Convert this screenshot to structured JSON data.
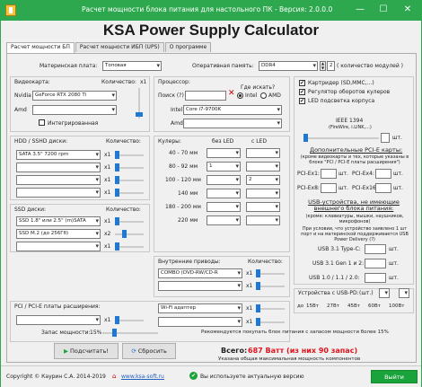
{
  "window": {
    "title": "Расчет мощности блока питания для настольного ПК - Версия: 2.0.0.0",
    "minimize": "—",
    "maximize": "☐",
    "close": "✕"
  },
  "brand": "KSA Power Supply Calculator",
  "tabs": [
    "Расчет мощности БП",
    "Расчет мощности ИБП (UPS)",
    "О программе"
  ],
  "motherboard": {
    "label": "Материнская плата:",
    "value": "Топовая"
  },
  "ram": {
    "label": "Оперативная память:",
    "value": "DDR4",
    "count": "2",
    "count_label": "( количество модулей )"
  },
  "video": {
    "title": "Видеокарта:",
    "count_label": "Количество:",
    "count": "x1",
    "nvidia": "Nvidia",
    "nvidia_value": "GeForce RTX 2080 Ti",
    "amd": "Amd",
    "amd_value": "",
    "integrated": "Интегрированная"
  },
  "cpu": {
    "title": "Процессор:",
    "search": "Поиск (?)",
    "search_value": "",
    "where": "Где искать?",
    "intel_radio": "Intel",
    "amd_radio": "AMD",
    "intel": "Intel",
    "intel_value": "Core i7-9700K",
    "amd": "Amd",
    "amd_value": ""
  },
  "right_checks": [
    {
      "label": "Картридер (SD,MMC,...)",
      "checked": true
    },
    {
      "label": "Регулятор оборотов кулеров",
      "checked": true
    },
    {
      "label": "LED подсветка корпуса",
      "checked": true
    }
  ],
  "ieee": {
    "label1": "IEEE 1394",
    "label2": "(FireWire, i.LINK,...)",
    "unit": "шт."
  },
  "pcie_cards": {
    "title": "Дополнительные PCI-E карты:",
    "note": "(кроме видеокарты и тех, которые указаны в блоке \"PCI / PCI-E платы расширения\")",
    "slots": [
      "PCI-Ex1:",
      "PCI-Ex4:",
      "PCI-Ex8:",
      "PCI-Ex16:"
    ],
    "unit": "шт."
  },
  "usb_devices": {
    "title": "USB-устройства, не имеющие внешнего блока питания:",
    "note": "(кроме: клавиатуры, мышки, наушников, микрофонов)",
    "note2": "При условии, что устройство заявлено 1 шт порт и на материнской поддерживается USB Power Delivery (?)",
    "rows": [
      "USB 3.1 Type-C:",
      "USB 3.1 Gen 1 и 2:",
      "USB 1.0 / 1.1 / 2.0:"
    ],
    "unit": "шт."
  },
  "usbpd": {
    "title": "Устройства с USB-PD:",
    "unit": "(шт.)",
    "watts": [
      "до",
      "15Вт",
      "27Вт",
      "45Вт",
      "60Вт",
      "100Вт"
    ]
  },
  "hdd": {
    "title": "HDD / SSHD диски:",
    "count_label": "Количество:",
    "rows": [
      {
        "value": "SATA 3.5\" 7200 rpm",
        "count": "x1"
      },
      {
        "value": "",
        "count": "x1"
      },
      {
        "value": "",
        "count": "x1"
      },
      {
        "value": "",
        "count": "x1"
      }
    ]
  },
  "coolers": {
    "title": "Кулеры:",
    "no_led": "без LED",
    "led": "с LED",
    "rows": [
      {
        "size": "40 - 70 мм",
        "a": "",
        "b": ""
      },
      {
        "size": "80 - 92 мм",
        "a": "1",
        "b": ""
      },
      {
        "size": "100 - 120 мм",
        "a": "",
        "b": "2"
      },
      {
        "size": "140 мм",
        "a": "",
        "b": ""
      },
      {
        "size": "180 - 200 мм",
        "a": "",
        "b": ""
      },
      {
        "size": "220 мм",
        "a": "",
        "b": ""
      }
    ]
  },
  "ssd": {
    "title": "SSD диски:",
    "count_label": "Количество:",
    "rows": [
      {
        "value": "SSD 1.8\" или 2.5\" (m)SATA",
        "count": "x1"
      },
      {
        "value": "SSD M.2 (до 256Гб)",
        "count": "x2"
      },
      {
        "value": "",
        "count": "x1"
      }
    ]
  },
  "optical": {
    "title": "Внутренние приводы:",
    "count_label": "Количество:",
    "rows": [
      {
        "value": "COMBO (DVD-RW/CD-R",
        "count": "x1"
      },
      {
        "value": "",
        "count": "x1"
      },
      {
        "value": "",
        "count": "x1"
      }
    ]
  },
  "pci": {
    "title": "PCI / PCI-E платы расширения:",
    "rows": [
      {
        "value": "",
        "count": "x1"
      },
      {
        "value": "Wi-Fi адаптер",
        "count": "x1"
      },
      {
        "value": "",
        "count": "x1"
      }
    ]
  },
  "reserve": {
    "label": "Запас мощности:",
    "value": "15%"
  },
  "recommend": "Рекомендуется покупать блок питания с запасом мощности более 15%",
  "buttons": {
    "calc": "Подсчитать!",
    "reset": "Сбросить"
  },
  "total": {
    "label": "Всего:",
    "value": "687 Ватт (из них 90 запас)"
  },
  "hint": "Указана общая максимальная мощность компонентов",
  "status": {
    "copyright": "Copyright © Каурин С.А. 2014-2019",
    "site": "www.ksa-soft.ru",
    "version_text": "Вы используете актуальную версию",
    "exit": "Выйти"
  },
  "colors": {
    "accent": "#2ea84e",
    "link": "#1f5fbf",
    "total": "#e0141e"
  }
}
